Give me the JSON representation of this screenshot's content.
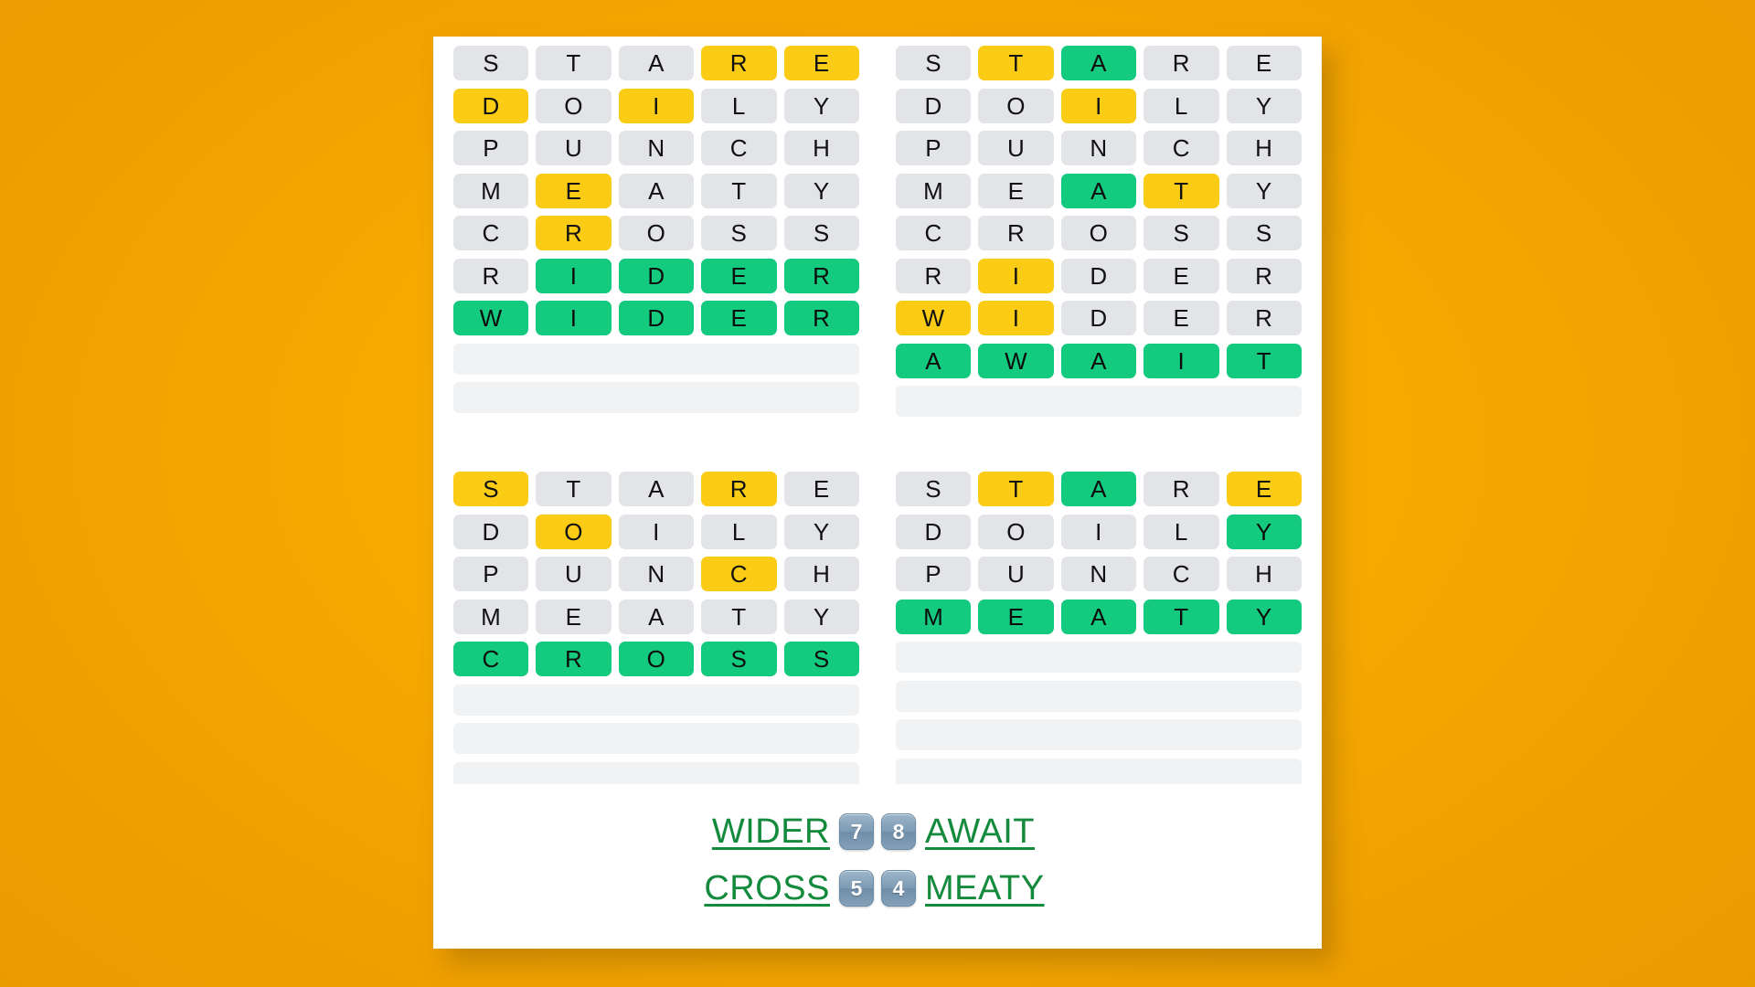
{
  "theme": {
    "background_color": "#f5a800",
    "card_color": "#ffffff",
    "tile_absent_color": "#e2e4e8",
    "tile_present_color": "#facc15",
    "tile_correct_color": "#13ca7f",
    "answer_link_color": "#138a3c",
    "badge_color": "#7d9bb4"
  },
  "boards": [
    {
      "id": "board-top-left",
      "answer": "WIDER",
      "guess_count": 7,
      "rows": [
        {
          "letters": [
            "S",
            "T",
            "A",
            "R",
            "E"
          ],
          "states": [
            "absent",
            "absent",
            "absent",
            "present",
            "present"
          ]
        },
        {
          "letters": [
            "D",
            "O",
            "I",
            "L",
            "Y"
          ],
          "states": [
            "present",
            "absent",
            "present",
            "absent",
            "absent"
          ]
        },
        {
          "letters": [
            "P",
            "U",
            "N",
            "C",
            "H"
          ],
          "states": [
            "absent",
            "absent",
            "absent",
            "absent",
            "absent"
          ]
        },
        {
          "letters": [
            "M",
            "E",
            "A",
            "T",
            "Y"
          ],
          "states": [
            "absent",
            "present",
            "absent",
            "absent",
            "absent"
          ]
        },
        {
          "letters": [
            "C",
            "R",
            "O",
            "S",
            "S"
          ],
          "states": [
            "absent",
            "present",
            "absent",
            "absent",
            "absent"
          ]
        },
        {
          "letters": [
            "R",
            "I",
            "D",
            "E",
            "R"
          ],
          "states": [
            "absent",
            "correct",
            "correct",
            "correct",
            "correct"
          ]
        },
        {
          "letters": [
            "W",
            "I",
            "D",
            "E",
            "R"
          ],
          "states": [
            "correct",
            "correct",
            "correct",
            "correct",
            "correct"
          ]
        },
        {
          "letters": [
            "",
            "",
            "",
            "",
            ""
          ],
          "states": [
            "empty",
            "empty",
            "empty",
            "empty",
            "empty"
          ]
        },
        {
          "letters": [
            "",
            "",
            "",
            "",
            ""
          ],
          "states": [
            "empty",
            "empty",
            "empty",
            "empty",
            "empty"
          ]
        }
      ]
    },
    {
      "id": "board-top-right",
      "answer": "AWAIT",
      "guess_count": 8,
      "rows": [
        {
          "letters": [
            "S",
            "T",
            "A",
            "R",
            "E"
          ],
          "states": [
            "absent",
            "present",
            "correct",
            "absent",
            "absent"
          ]
        },
        {
          "letters": [
            "D",
            "O",
            "I",
            "L",
            "Y"
          ],
          "states": [
            "absent",
            "absent",
            "present",
            "absent",
            "absent"
          ]
        },
        {
          "letters": [
            "P",
            "U",
            "N",
            "C",
            "H"
          ],
          "states": [
            "absent",
            "absent",
            "absent",
            "absent",
            "absent"
          ]
        },
        {
          "letters": [
            "M",
            "E",
            "A",
            "T",
            "Y"
          ],
          "states": [
            "absent",
            "absent",
            "correct",
            "present",
            "absent"
          ]
        },
        {
          "letters": [
            "C",
            "R",
            "O",
            "S",
            "S"
          ],
          "states": [
            "absent",
            "absent",
            "absent",
            "absent",
            "absent"
          ]
        },
        {
          "letters": [
            "R",
            "I",
            "D",
            "E",
            "R"
          ],
          "states": [
            "absent",
            "present",
            "absent",
            "absent",
            "absent"
          ]
        },
        {
          "letters": [
            "W",
            "I",
            "D",
            "E",
            "R"
          ],
          "states": [
            "present",
            "present",
            "absent",
            "absent",
            "absent"
          ]
        },
        {
          "letters": [
            "A",
            "W",
            "A",
            "I",
            "T"
          ],
          "states": [
            "correct",
            "correct",
            "correct",
            "correct",
            "correct"
          ]
        },
        {
          "letters": [
            "",
            "",
            "",
            "",
            ""
          ],
          "states": [
            "empty",
            "empty",
            "empty",
            "empty",
            "empty"
          ]
        }
      ]
    },
    {
      "id": "board-bottom-left",
      "answer": "CROSS",
      "guess_count": 5,
      "rows": [
        {
          "letters": [
            "S",
            "T",
            "A",
            "R",
            "E"
          ],
          "states": [
            "present",
            "absent",
            "absent",
            "present",
            "absent"
          ]
        },
        {
          "letters": [
            "D",
            "O",
            "I",
            "L",
            "Y"
          ],
          "states": [
            "absent",
            "present",
            "absent",
            "absent",
            "absent"
          ]
        },
        {
          "letters": [
            "P",
            "U",
            "N",
            "C",
            "H"
          ],
          "states": [
            "absent",
            "absent",
            "absent",
            "present",
            "absent"
          ]
        },
        {
          "letters": [
            "M",
            "E",
            "A",
            "T",
            "Y"
          ],
          "states": [
            "absent",
            "absent",
            "absent",
            "absent",
            "absent"
          ]
        },
        {
          "letters": [
            "C",
            "R",
            "O",
            "S",
            "S"
          ],
          "states": [
            "correct",
            "correct",
            "correct",
            "correct",
            "correct"
          ]
        },
        {
          "letters": [
            "",
            "",
            "",
            "",
            ""
          ],
          "states": [
            "empty",
            "empty",
            "empty",
            "empty",
            "empty"
          ]
        },
        {
          "letters": [
            "",
            "",
            "",
            "",
            ""
          ],
          "states": [
            "empty",
            "empty",
            "empty",
            "empty",
            "empty"
          ]
        },
        {
          "letters": [
            "",
            "",
            "",
            "",
            ""
          ],
          "states": [
            "empty",
            "empty",
            "empty",
            "empty",
            "empty"
          ]
        },
        {
          "letters": [
            "",
            "",
            "",
            "",
            ""
          ],
          "states": [
            "empty",
            "empty",
            "empty",
            "empty",
            "empty"
          ]
        }
      ]
    },
    {
      "id": "board-bottom-right",
      "answer": "MEATY",
      "guess_count": 4,
      "rows": [
        {
          "letters": [
            "S",
            "T",
            "A",
            "R",
            "E"
          ],
          "states": [
            "absent",
            "present",
            "correct",
            "absent",
            "present"
          ]
        },
        {
          "letters": [
            "D",
            "O",
            "I",
            "L",
            "Y"
          ],
          "states": [
            "absent",
            "absent",
            "absent",
            "absent",
            "correct"
          ]
        },
        {
          "letters": [
            "P",
            "U",
            "N",
            "C",
            "H"
          ],
          "states": [
            "absent",
            "absent",
            "absent",
            "absent",
            "absent"
          ]
        },
        {
          "letters": [
            "M",
            "E",
            "A",
            "T",
            "Y"
          ],
          "states": [
            "correct",
            "correct",
            "correct",
            "correct",
            "correct"
          ]
        },
        {
          "letters": [
            "",
            "",
            "",
            "",
            ""
          ],
          "states": [
            "empty",
            "empty",
            "empty",
            "empty",
            "empty"
          ]
        },
        {
          "letters": [
            "",
            "",
            "",
            "",
            ""
          ],
          "states": [
            "empty",
            "empty",
            "empty",
            "empty",
            "empty"
          ]
        },
        {
          "letters": [
            "",
            "",
            "",
            "",
            ""
          ],
          "states": [
            "empty",
            "empty",
            "empty",
            "empty",
            "empty"
          ]
        },
        {
          "letters": [
            "",
            "",
            "",
            "",
            ""
          ],
          "states": [
            "empty",
            "empty",
            "empty",
            "empty",
            "empty"
          ]
        },
        {
          "letters": [
            "",
            "",
            "",
            "",
            ""
          ],
          "states": [
            "empty",
            "empty",
            "empty",
            "empty",
            "empty"
          ]
        }
      ]
    }
  ],
  "footer": {
    "lines": [
      {
        "left_word": "WIDER",
        "left_count": "7",
        "right_count": "8",
        "right_word": "AWAIT"
      },
      {
        "left_word": "CROSS",
        "left_count": "5",
        "right_count": "4",
        "right_word": "MEATY"
      }
    ]
  }
}
